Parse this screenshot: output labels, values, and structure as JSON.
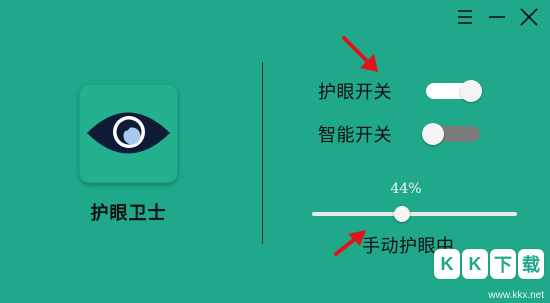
{
  "window": {
    "controls": {
      "menu_icon": "hamburger-icon",
      "minimize_icon": "minimize-icon",
      "close_icon": "close-icon"
    }
  },
  "app": {
    "name": "护眼卫士",
    "icon": "eye-icon"
  },
  "toggles": [
    {
      "label": "护眼开关",
      "state": "on"
    },
    {
      "label": "智能开关",
      "state": "off"
    }
  ],
  "slider": {
    "value_text": "44%",
    "value": 0.44
  },
  "mode_label": "手动护眼中",
  "watermark": {
    "badges": [
      "K",
      "K",
      "下",
      "载"
    ],
    "url": "www.kkx.net"
  },
  "colors": {
    "background": "#1fa88a",
    "eye_dark": "#0f1b36",
    "arrow": "#e0151b"
  }
}
